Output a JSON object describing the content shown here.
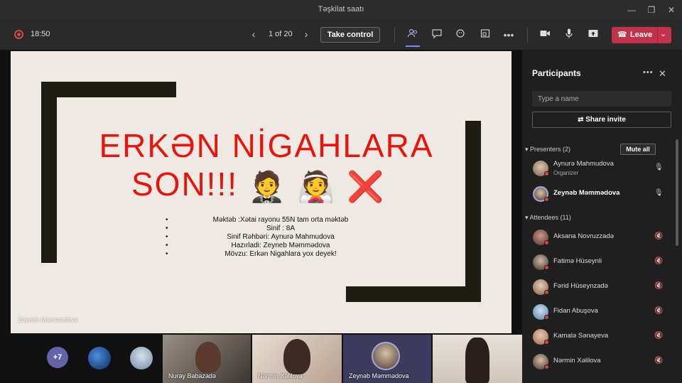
{
  "window": {
    "title": "Təşkilat saatı"
  },
  "toolbar": {
    "timer": "18:50",
    "page": "1 of 20",
    "take_control": "Take control",
    "leave": "Leave"
  },
  "slide": {
    "title_line1": "ERKƏN NİGAHLARA",
    "title_line2": "SON!!!",
    "emojis": [
      "🤵",
      "👰",
      "❌"
    ],
    "bullets": [
      "Məktəb :Xətai rayonu  55N tam orta məktəb",
      "Sinif : 8A",
      "Sinif Rəhbəri: Aynurə Mahmudova",
      "Hazırladi: Zeyneb Məmmədova",
      "Mövzu: Erkən Nigahlara yox deyek!"
    ],
    "presenter_label": "Zeyneb Məmmədova"
  },
  "strip": {
    "more_count": "+7",
    "tiles": [
      {
        "name": "Nuray Babazadə"
      },
      {
        "name": "Nərmin Xəlilova"
      },
      {
        "name": "Zeynəb Məmmədova"
      },
      {
        "name": ""
      }
    ]
  },
  "panel": {
    "title": "Participants",
    "search_placeholder": "Type a name",
    "share_invite": "Share invite",
    "presenters_header": "Presenters (2)",
    "mute_all": "Mute all",
    "presenters": [
      {
        "name": "Aynurə Mahmudova",
        "role": "Organizer"
      },
      {
        "name": "Zeynəb Məmmədova",
        "role": ""
      }
    ],
    "attendees_header": "Attendees (11)",
    "attendees": [
      {
        "name": "Aksana Novruzzadə"
      },
      {
        "name": "Fatimə Hüseynli"
      },
      {
        "name": "Fərid Hüseynzadə"
      },
      {
        "name": "Fidan Abuşova"
      },
      {
        "name": "Kamalə Sənayeva"
      },
      {
        "name": "Nərmin Xəlilova"
      }
    ]
  },
  "colors": {
    "accent": "#6264a7",
    "leave": "#c4314b",
    "slide_title": "#e8140c"
  }
}
